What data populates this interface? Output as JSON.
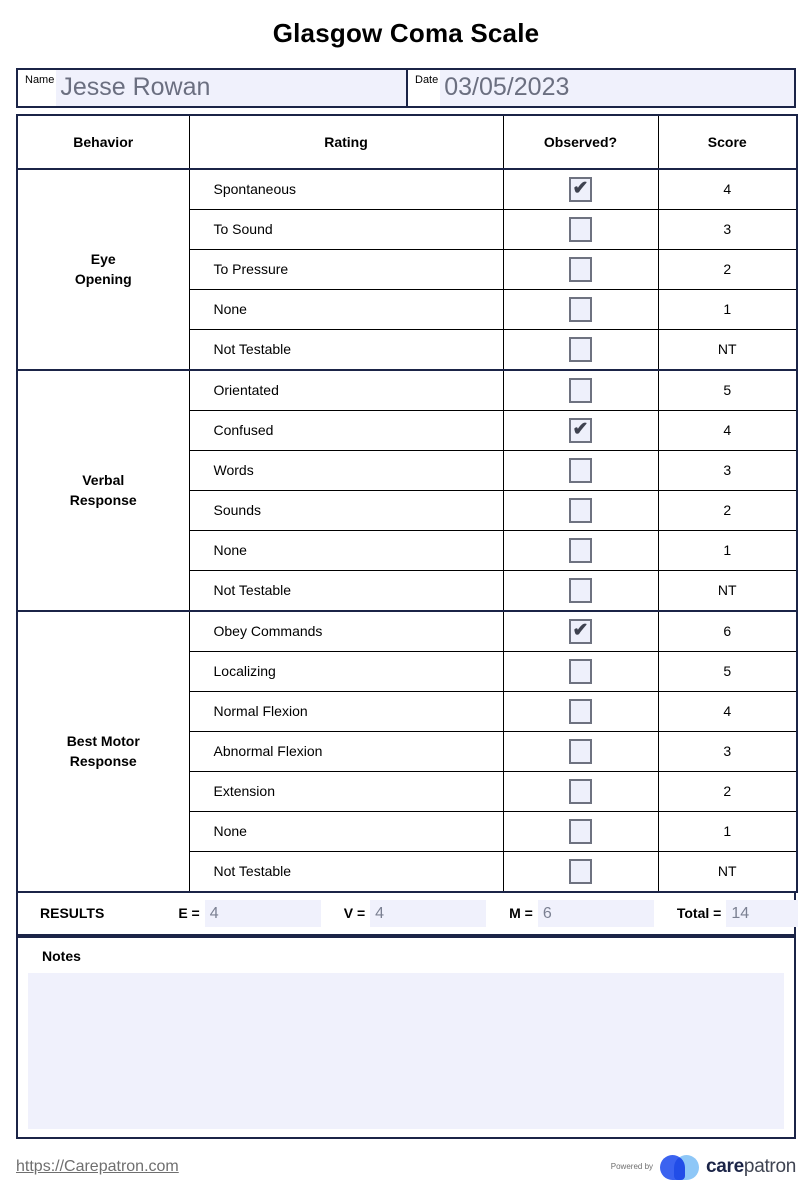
{
  "document": {
    "title": "Glasgow Coma Scale"
  },
  "identity": {
    "name_label": "Name",
    "name_value": "Jesse Rowan",
    "date_label": "Date",
    "date_value": "03/05/2023"
  },
  "table": {
    "headers": {
      "behavior": "Behavior",
      "rating": "Rating",
      "observed": "Observed?",
      "score": "Score"
    },
    "sections": [
      {
        "behavior": "Eye\nOpening",
        "behavior_line1": "Eye",
        "behavior_line2": "Opening",
        "rows": [
          {
            "rating": "Spontaneous",
            "checked": true,
            "score": "4"
          },
          {
            "rating": "To Sound",
            "checked": false,
            "score": "3"
          },
          {
            "rating": "To Pressure",
            "checked": false,
            "score": "2"
          },
          {
            "rating": "None",
            "checked": false,
            "score": "1"
          },
          {
            "rating": "Not Testable",
            "checked": false,
            "score": "NT"
          }
        ]
      },
      {
        "behavior": "Verbal\nResponse",
        "behavior_line1": "Verbal",
        "behavior_line2": "Response",
        "rows": [
          {
            "rating": "Orientated",
            "checked": false,
            "score": "5"
          },
          {
            "rating": "Confused",
            "checked": true,
            "score": "4"
          },
          {
            "rating": "Words",
            "checked": false,
            "score": "3"
          },
          {
            "rating": "Sounds",
            "checked": false,
            "score": "2"
          },
          {
            "rating": "None",
            "checked": false,
            "score": "1"
          },
          {
            "rating": "Not Testable",
            "checked": false,
            "score": "NT"
          }
        ]
      },
      {
        "behavior": "Best Motor\nResponse",
        "behavior_line1": "Best Motor",
        "behavior_line2": "Response",
        "rows": [
          {
            "rating": "Obey Commands",
            "checked": true,
            "score": "6"
          },
          {
            "rating": "Localizing",
            "checked": false,
            "score": "5"
          },
          {
            "rating": "Normal Flexion",
            "checked": false,
            "score": "4"
          },
          {
            "rating": "Abnormal Flexion",
            "checked": false,
            "score": "3"
          },
          {
            "rating": "Extension",
            "checked": false,
            "score": "2"
          },
          {
            "rating": "None",
            "checked": false,
            "score": "1"
          },
          {
            "rating": "Not Testable",
            "checked": false,
            "score": "NT"
          }
        ]
      }
    ]
  },
  "results": {
    "title": "RESULTS",
    "eye_label": "E =",
    "eye_value": "4",
    "verbal_label": "V =",
    "verbal_value": "4",
    "motor_label": "M =",
    "motor_value": "6",
    "total_label": "Total =",
    "total_value": "14"
  },
  "notes": {
    "label": "Notes",
    "value": ""
  },
  "footer": {
    "url": "https://Carepatron.com",
    "powered_by": "Powered by",
    "brand_bold": "care",
    "brand_light": "patron"
  },
  "colors": {
    "border": "#1b2447",
    "field_fill": "#f0f1fc",
    "field_text": "#6b6f80",
    "logo_dark": "#3b63f0",
    "logo_light": "#8ec7f7"
  },
  "icons": {
    "checkmark": "✔"
  }
}
